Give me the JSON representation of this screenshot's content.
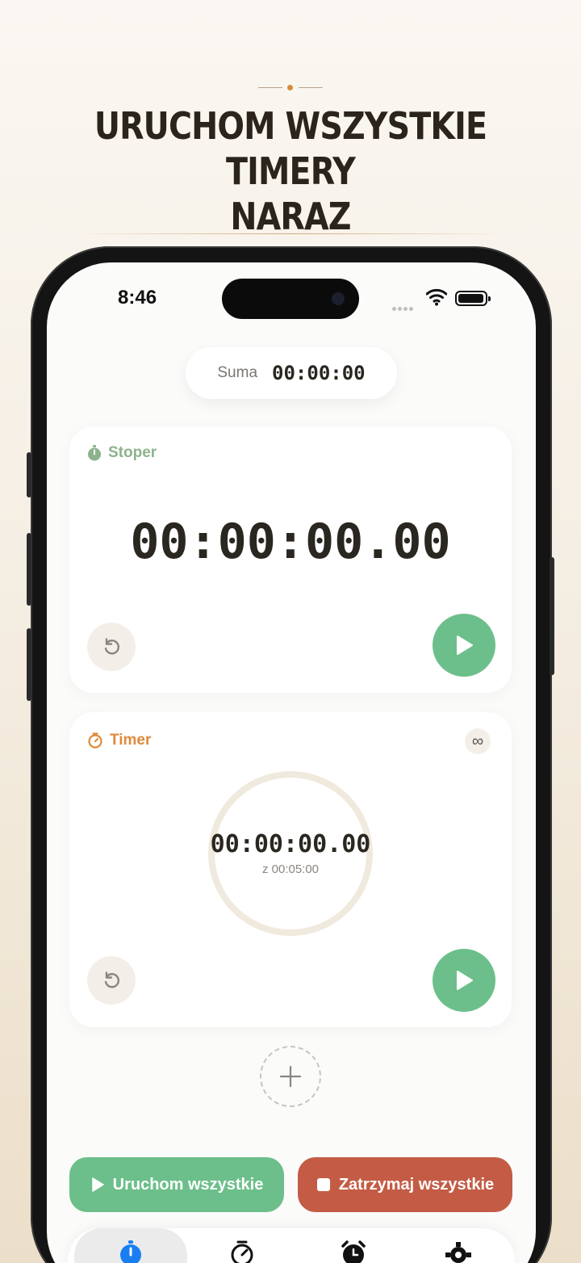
{
  "promo": {
    "headline_line1": "URUCHOM WSZYSTKIE TIMERY",
    "headline_line2": "NARAZ"
  },
  "status_bar": {
    "time": "8:46"
  },
  "summary": {
    "label": "Suma",
    "value": "00:00:00"
  },
  "stopwatch_card": {
    "title": "Stoper",
    "time": "00:00:00.00",
    "accent": "#8db38e"
  },
  "timer_card": {
    "title": "Timer",
    "time": "00:00:00.00",
    "total": "z 00:05:00",
    "accent": "#e08a3a",
    "progress": 0
  },
  "actions": {
    "run_all": "Uruchom wszystkie",
    "stop_all": "Zatrzymaj wszystkie"
  },
  "tabs": [
    {
      "icon": "stopwatch-icon",
      "active": true
    },
    {
      "icon": "timer-icon",
      "active": false
    },
    {
      "icon": "alarm-clock-icon",
      "active": false
    },
    {
      "icon": "gear-icon",
      "active": false
    }
  ],
  "colors": {
    "green": "#6cbf8a",
    "red": "#c45c45",
    "accent_orange": "#e08a3a",
    "accent_blue": "#1a7ef0"
  }
}
